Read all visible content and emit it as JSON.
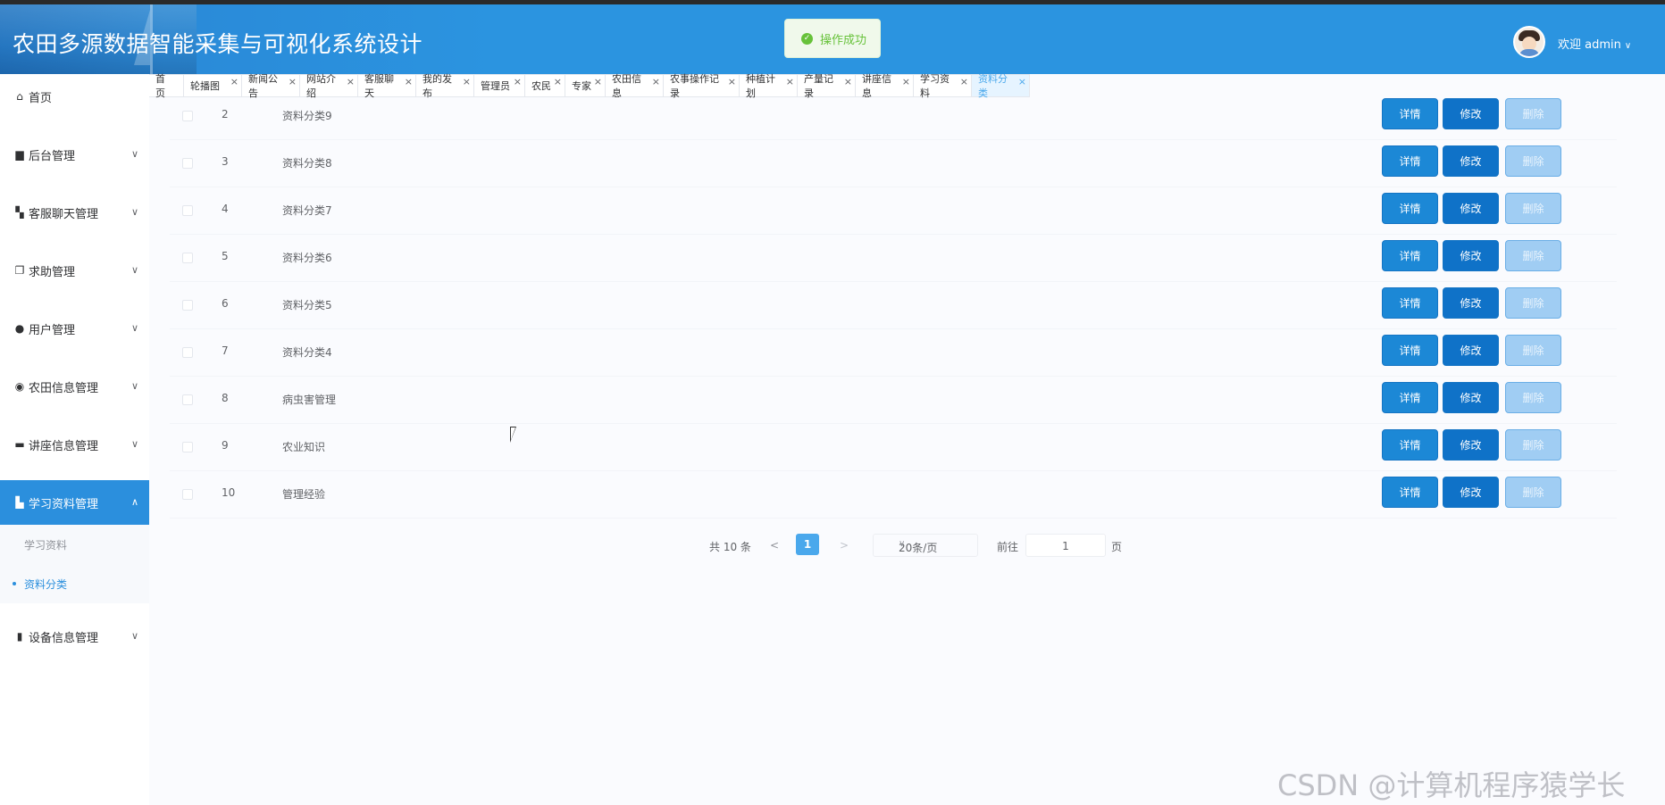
{
  "header": {
    "title": "农田多源数据智能采集与可视化系统设计",
    "toast": "操作成功",
    "welcome": "欢迎 admin"
  },
  "sidebar": {
    "items": [
      {
        "label": "首页",
        "icon": "home-icon"
      },
      {
        "label": "后台管理",
        "icon": "folder-icon"
      },
      {
        "label": "客服聊天管理",
        "icon": "dashboard-icon"
      },
      {
        "label": "求助管理",
        "icon": "copy-icon"
      },
      {
        "label": "用户管理",
        "icon": "user-icon"
      },
      {
        "label": "农田信息管理",
        "icon": "compass-icon"
      },
      {
        "label": "讲座信息管理",
        "icon": "briefcase-icon"
      },
      {
        "label": "学习资料管理",
        "icon": "files-icon"
      },
      {
        "label": "设备信息管理",
        "icon": "book-icon"
      }
    ],
    "submenu": [
      {
        "label": "学习资料"
      },
      {
        "label": "资料分类"
      }
    ]
  },
  "tabs": [
    "首页",
    "轮播图",
    "新闻公告",
    "网站介绍",
    "客服聊天",
    "我的发布",
    "管理员",
    "农民",
    "专家",
    "农田信息",
    "农事操作记录",
    "种植计划",
    "产量记录",
    "讲座信息",
    "学习资料",
    "资料分类"
  ],
  "table": {
    "rows": [
      {
        "index": "2",
        "name": "资料分类9"
      },
      {
        "index": "3",
        "name": "资料分类8"
      },
      {
        "index": "4",
        "name": "资料分类7"
      },
      {
        "index": "5",
        "name": "资料分类6"
      },
      {
        "index": "6",
        "name": "资料分类5"
      },
      {
        "index": "7",
        "name": "资料分类4"
      },
      {
        "index": "8",
        "name": "病虫害管理"
      },
      {
        "index": "9",
        "name": "农业知识"
      },
      {
        "index": "10",
        "name": "管理经验"
      }
    ],
    "actions": {
      "detail": "详情",
      "edit": "修改",
      "delete": "删除"
    }
  },
  "pager": {
    "total": "共 10 条",
    "prev": "<",
    "current": "1",
    "next": ">",
    "page_size": "20条/页",
    "goto": "前往",
    "goto_value": "1",
    "page_suffix": "页"
  },
  "watermark": "CSDN @计算机程序猿学长",
  "colors": {
    "header": "#2b94e0",
    "accent": "#2b8fdd",
    "success": "#67c23a"
  }
}
